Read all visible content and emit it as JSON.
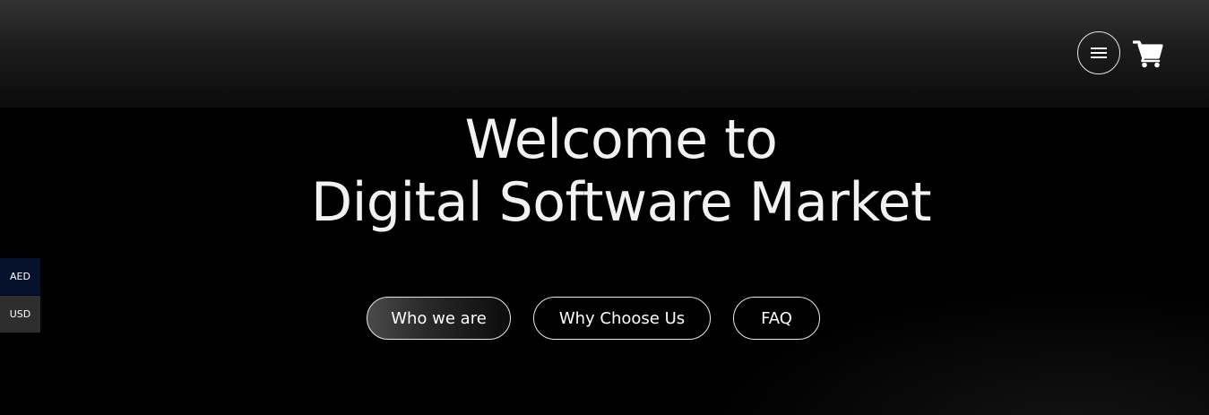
{
  "header": {
    "menu_icon": "hamburger-icon",
    "cart_icon": "shopping-cart-icon"
  },
  "hero": {
    "title_line1": "Welcome to",
    "title_line2": "Digital Software Market"
  },
  "nav_pills": [
    {
      "label": "Who we are",
      "active": true
    },
    {
      "label": "Why Choose Us",
      "active": false
    },
    {
      "label": "FAQ",
      "active": false
    }
  ],
  "currency_switcher": [
    {
      "label": "AED",
      "color": "#06122b"
    },
    {
      "label": "USD",
      "color": "#2e2e2e"
    }
  ]
}
